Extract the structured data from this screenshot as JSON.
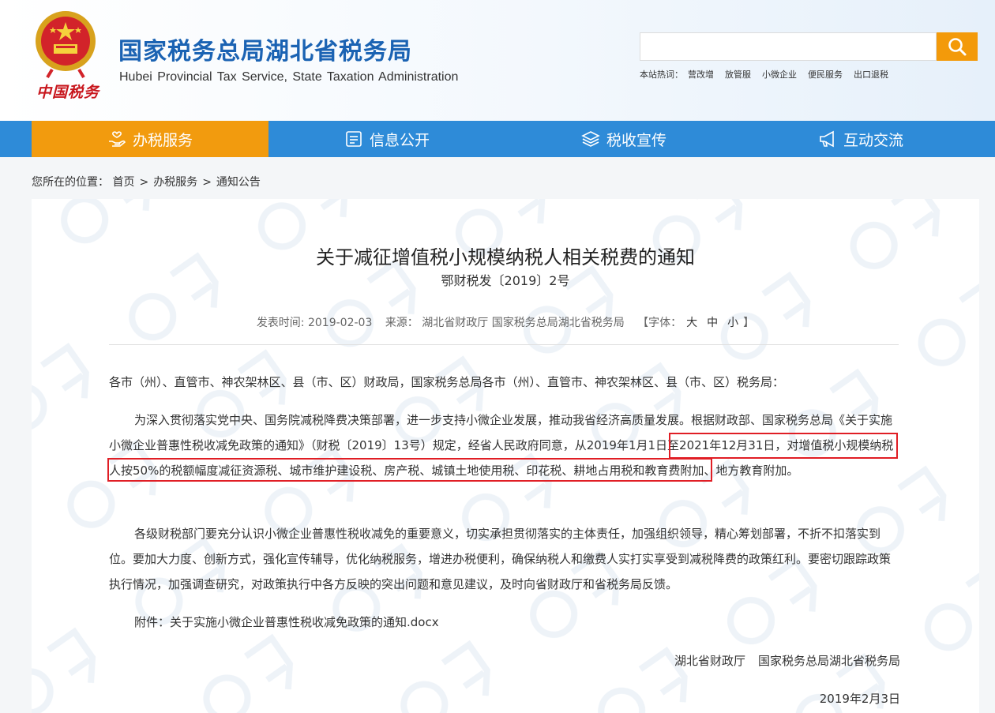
{
  "colors": {
    "brand_blue": "#1b63b3",
    "nav_blue": "#2e8bd8",
    "accent_orange": "#f29b0e",
    "highlight_red": "#e01e25"
  },
  "header": {
    "logo_text": "中国税务",
    "title": "国家税务总局湖北省税务局",
    "subtitle": "Hubei  Provincial Tax Service, State  Taxation  Administration",
    "search": {
      "placeholder": "",
      "button_icon": "search-icon"
    },
    "hot_label": "本站热词：",
    "hot_words": [
      "营改增",
      "放管服",
      "小微企业",
      "便民服务",
      "出口退税"
    ]
  },
  "nav": {
    "items": [
      {
        "label": "办税服务",
        "icon": "hand-heart-icon",
        "active": true
      },
      {
        "label": "信息公开",
        "icon": "info-board-icon",
        "active": false
      },
      {
        "label": "税收宣传",
        "icon": "layers-icon",
        "active": false
      },
      {
        "label": "互动交流",
        "icon": "megaphone-icon",
        "active": false
      }
    ]
  },
  "breadcrumb": {
    "label": "您所在的位置：",
    "items": [
      "首页",
      "办税服务",
      "通知公告"
    ],
    "sep": ">"
  },
  "article": {
    "title": "关于减征增值税小规模纳税人相关税费的通知",
    "doc_no": "鄂财税发〔2019〕2号",
    "meta": {
      "publish_label": "发表时间:",
      "publish_date": "2019-02-03",
      "source_label": "来源：",
      "source": "湖北省财政厅 国家税务总局湖北省税务局",
      "font_label_open": "【字体：",
      "font_large": "大",
      "font_medium": "中",
      "font_small": "小",
      "font_label_close": "】"
    },
    "greeting": "各市（州）、直管市、神农架林区、县（市、区）财政局，国家税务总局各市（州）、直管市、神农架林区、县（市、区）税务局：",
    "para1": "为深入贯彻落实党中央、国务院减税降费决策部署，进一步支持小微企业发展，推动我省经济高质量发展。根据财政部、国家税务总局《关于实施小微企业普惠性税收减免政策的通知》（财税〔2019〕13号）规定，经省人民政府同意，从2019年1月1日至2021年12月31日，对增值税小规模纳税人按50%的税额幅度减征资源税、城市维护建设税、房产税、城镇土地使用税、印花税、耕地占用税和教育费附加、地方教育附加。",
    "para2": "各级财税部门要充分认识小微企业普惠性税收减免的重要意义，切实承担贯彻落实的主体责任，加强组织领导，精心筹划部署，不折不扣落实到位。要加大力度、创新方式，强化宣传辅导，优化纳税服务，增进办税便利，确保纳税人和缴费人实打实享受到减税降费的政策红利。要密切跟踪政策执行情况，加强调查研究，对政策执行中各方反映的突出问题和意见建议，及时向省财政厅和省税务局反馈。",
    "attachment_label": "附件：",
    "attachment_name": "关于实施小微企业普惠性税收减免政策的通知.docx",
    "signer1": "湖北省财政厅",
    "signer2": "国家税务总局湖北省税务局",
    "date": "2019年2月3日"
  }
}
